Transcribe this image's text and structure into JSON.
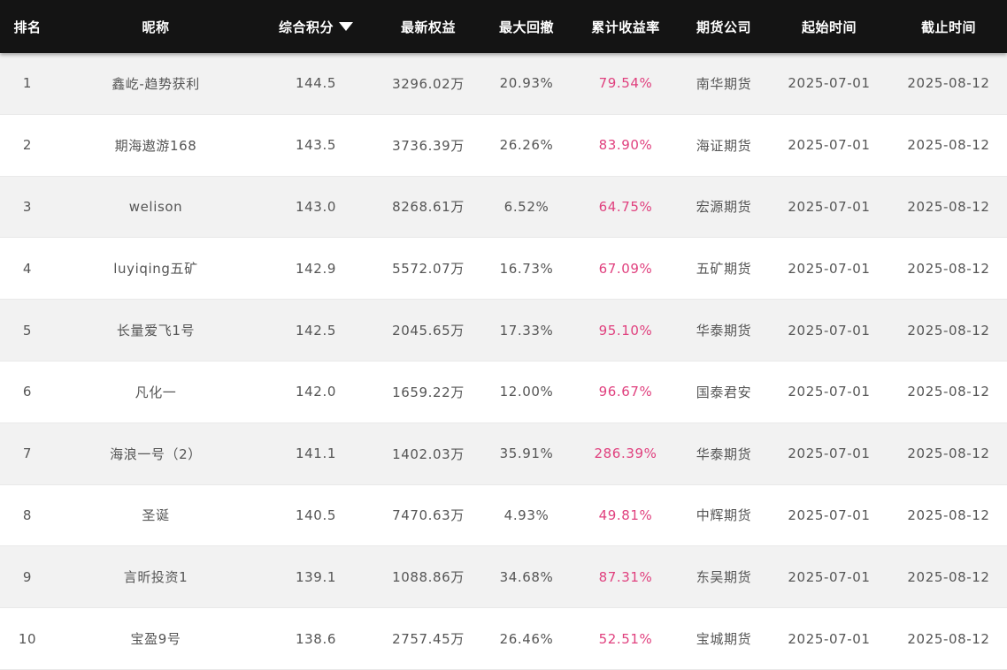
{
  "columns": {
    "rank": "排名",
    "nickname": "昵称",
    "score": "综合积分",
    "equity": "最新权益",
    "drawdown": "最大回撤",
    "return": "累计收益率",
    "company": "期货公司",
    "start": "起始时间",
    "end": "截止时间"
  },
  "sort_icon": "sort-desc-triangle-icon",
  "colors": {
    "header_bg": "#141414",
    "row_odd": "#f2f2f2",
    "row_even": "#ffffff",
    "return_text": "#e0407e",
    "body_text": "#555555"
  },
  "rows": [
    {
      "rank": "1",
      "nickname": "鑫屹-趋势获利",
      "score": "144.5",
      "equity": "3296.02万",
      "drawdown": "20.93%",
      "return": "79.54%",
      "company": "南华期货",
      "start": "2025-07-01",
      "end": "2025-08-12"
    },
    {
      "rank": "2",
      "nickname": "期海遨游168",
      "score": "143.5",
      "equity": "3736.39万",
      "drawdown": "26.26%",
      "return": "83.90%",
      "company": "海证期货",
      "start": "2025-07-01",
      "end": "2025-08-12"
    },
    {
      "rank": "3",
      "nickname": "welison",
      "score": "143.0",
      "equity": "8268.61万",
      "drawdown": "6.52%",
      "return": "64.75%",
      "company": "宏源期货",
      "start": "2025-07-01",
      "end": "2025-08-12"
    },
    {
      "rank": "4",
      "nickname": "luyiqing五矿",
      "score": "142.9",
      "equity": "5572.07万",
      "drawdown": "16.73%",
      "return": "67.09%",
      "company": "五矿期货",
      "start": "2025-07-01",
      "end": "2025-08-12"
    },
    {
      "rank": "5",
      "nickname": "长量爱飞1号",
      "score": "142.5",
      "equity": "2045.65万",
      "drawdown": "17.33%",
      "return": "95.10%",
      "company": "华泰期货",
      "start": "2025-07-01",
      "end": "2025-08-12"
    },
    {
      "rank": "6",
      "nickname": "凡化一",
      "score": "142.0",
      "equity": "1659.22万",
      "drawdown": "12.00%",
      "return": "96.67%",
      "company": "国泰君安",
      "start": "2025-07-01",
      "end": "2025-08-12"
    },
    {
      "rank": "7",
      "nickname": "海浪一号（2）",
      "score": "141.1",
      "equity": "1402.03万",
      "drawdown": "35.91%",
      "return": "286.39%",
      "company": "华泰期货",
      "start": "2025-07-01",
      "end": "2025-08-12"
    },
    {
      "rank": "8",
      "nickname": "圣诞",
      "score": "140.5",
      "equity": "7470.63万",
      "drawdown": "4.93%",
      "return": "49.81%",
      "company": "中辉期货",
      "start": "2025-07-01",
      "end": "2025-08-12"
    },
    {
      "rank": "9",
      "nickname": "言昕投资1",
      "score": "139.1",
      "equity": "1088.86万",
      "drawdown": "34.68%",
      "return": "87.31%",
      "company": "东吴期货",
      "start": "2025-07-01",
      "end": "2025-08-12"
    },
    {
      "rank": "10",
      "nickname": "宝盈9号",
      "score": "138.6",
      "equity": "2757.45万",
      "drawdown": "26.46%",
      "return": "52.51%",
      "company": "宝城期货",
      "start": "2025-07-01",
      "end": "2025-08-12"
    }
  ]
}
